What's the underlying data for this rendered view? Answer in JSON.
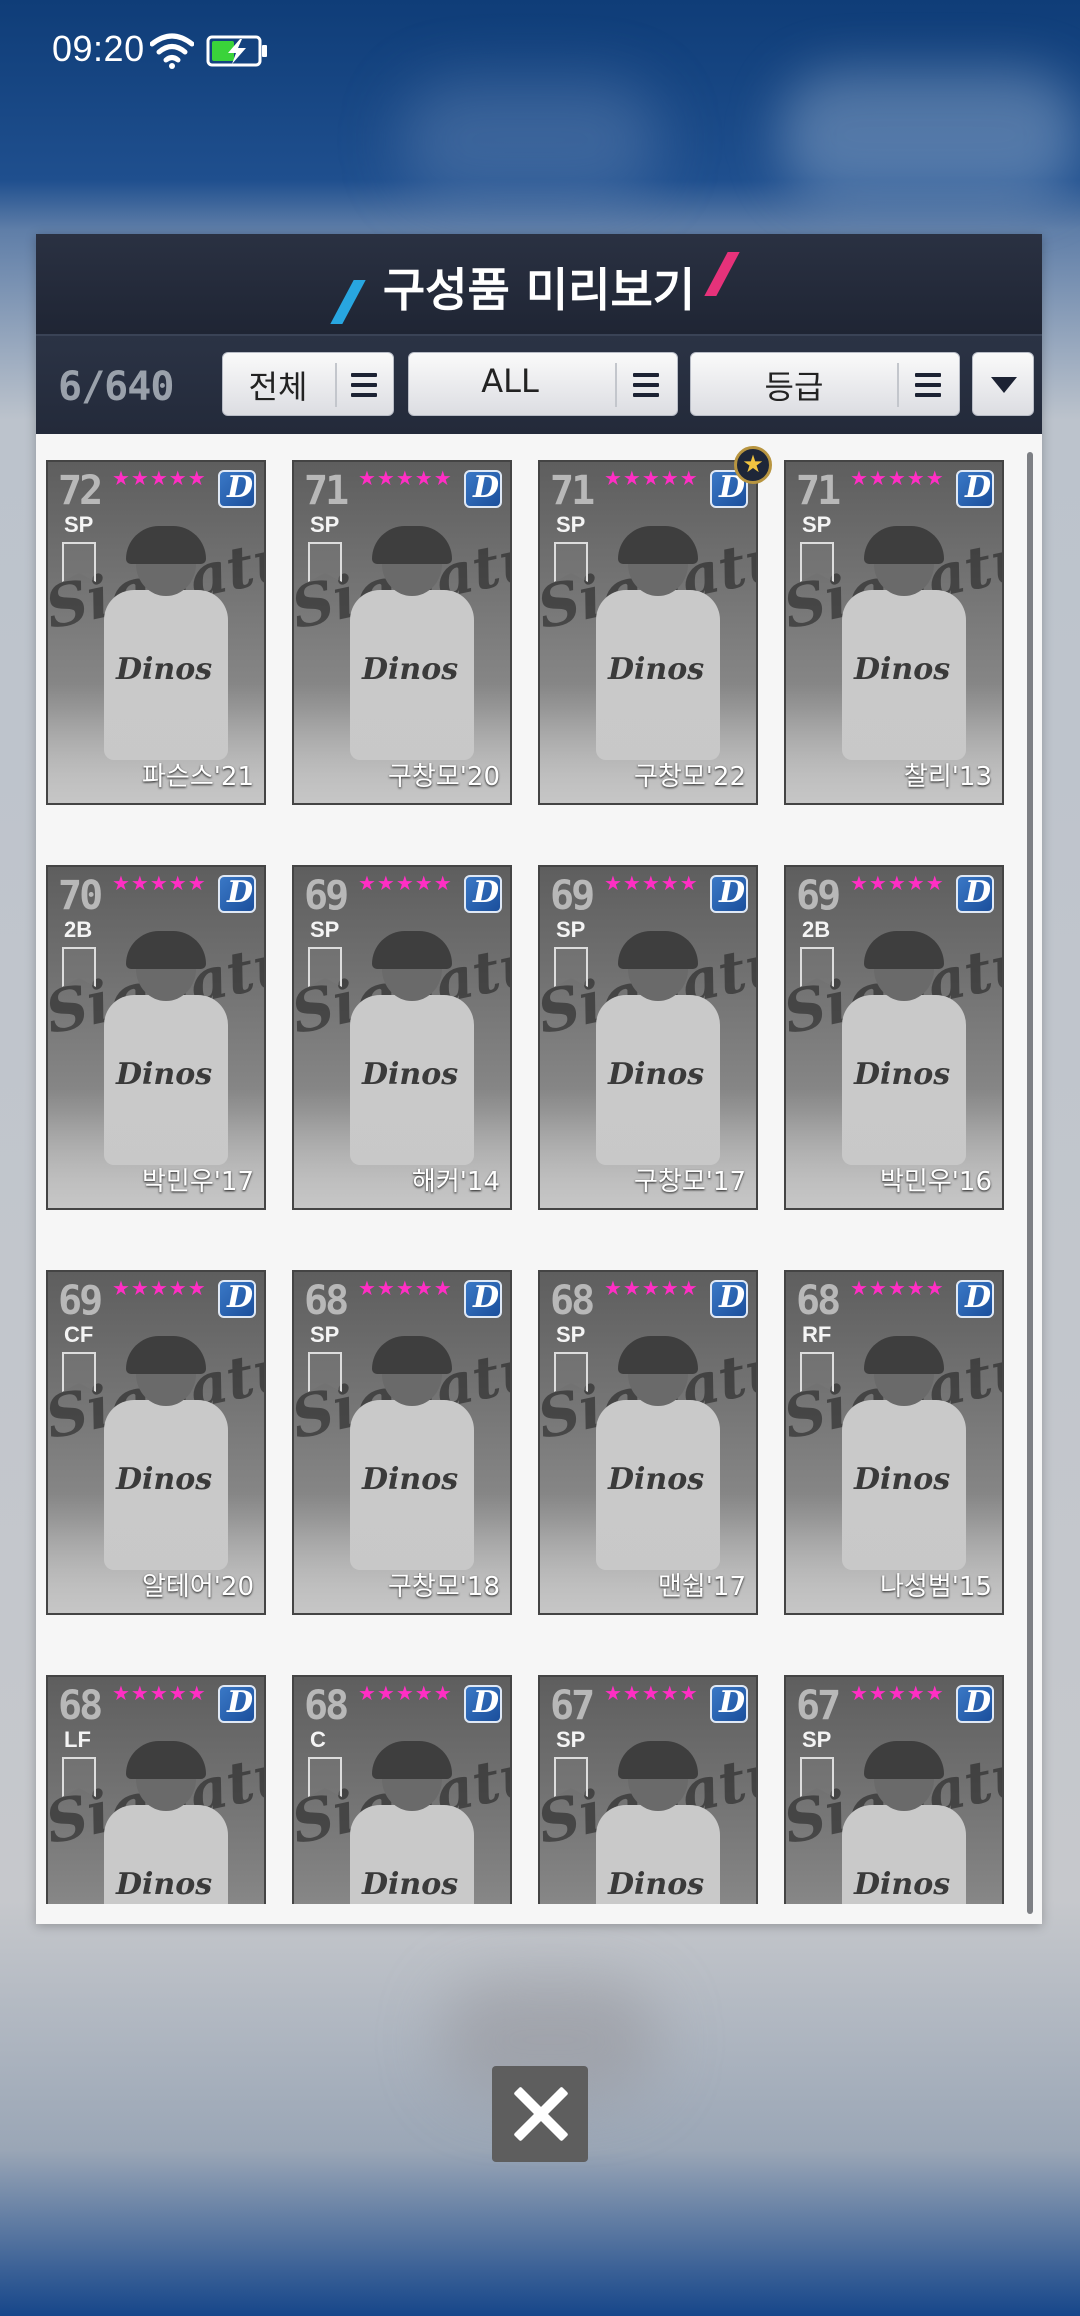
{
  "status_bar": {
    "time": "09:20",
    "wifi_icon": "wifi-icon",
    "battery_icon": "battery-charging-icon"
  },
  "modal": {
    "title": "구성품 미리보기",
    "count": "6/640",
    "filters": {
      "type": "전체",
      "team": "ALL",
      "grade": "등급"
    },
    "icons": {
      "menu": "menu-icon",
      "sort": "chevron-down-icon",
      "close": "close-icon"
    }
  },
  "cards": [
    {
      "rating": "72",
      "position": "SP",
      "name": "파슨스'21",
      "stars": "★★★★★",
      "badge": false
    },
    {
      "rating": "71",
      "position": "SP",
      "name": "구창모'20",
      "stars": "★★★★★",
      "badge": false
    },
    {
      "rating": "71",
      "position": "SP",
      "name": "구창모'22",
      "stars": "★★★★★",
      "badge": true
    },
    {
      "rating": "71",
      "position": "SP",
      "name": "찰리'13",
      "stars": "★★★★★",
      "badge": false
    },
    {
      "rating": "70",
      "position": "2B",
      "name": "박민우'17",
      "stars": "★★★★★",
      "badge": false
    },
    {
      "rating": "69",
      "position": "SP",
      "name": "해커'14",
      "stars": "★★★★★",
      "badge": false
    },
    {
      "rating": "69",
      "position": "SP",
      "name": "구창모'17",
      "stars": "★★★★★",
      "badge": false
    },
    {
      "rating": "69",
      "position": "2B",
      "name": "박민우'16",
      "stars": "★★★★★",
      "badge": false
    },
    {
      "rating": "69",
      "position": "CF",
      "name": "알테어'20",
      "stars": "★★★★★",
      "badge": false
    },
    {
      "rating": "68",
      "position": "SP",
      "name": "구창모'18",
      "stars": "★★★★★",
      "badge": false
    },
    {
      "rating": "68",
      "position": "SP",
      "name": "맨쉽'17",
      "stars": "★★★★★",
      "badge": false
    },
    {
      "rating": "68",
      "position": "RF",
      "name": "나성범'15",
      "stars": "★★★★★",
      "badge": false
    },
    {
      "rating": "68",
      "position": "LF",
      "name": "",
      "stars": "★★★★★",
      "badge": false
    },
    {
      "rating": "68",
      "position": "C",
      "name": "",
      "stars": "★★★★★",
      "badge": false
    },
    {
      "rating": "67",
      "position": "SP",
      "name": "",
      "stars": "★★★★★",
      "badge": false
    },
    {
      "rating": "67",
      "position": "SP",
      "name": "",
      "stars": "★★★★★",
      "badge": false
    }
  ],
  "card_decor": {
    "signature_word": "Signature",
    "team_letter": "D",
    "jersey_text": "Dinos"
  }
}
